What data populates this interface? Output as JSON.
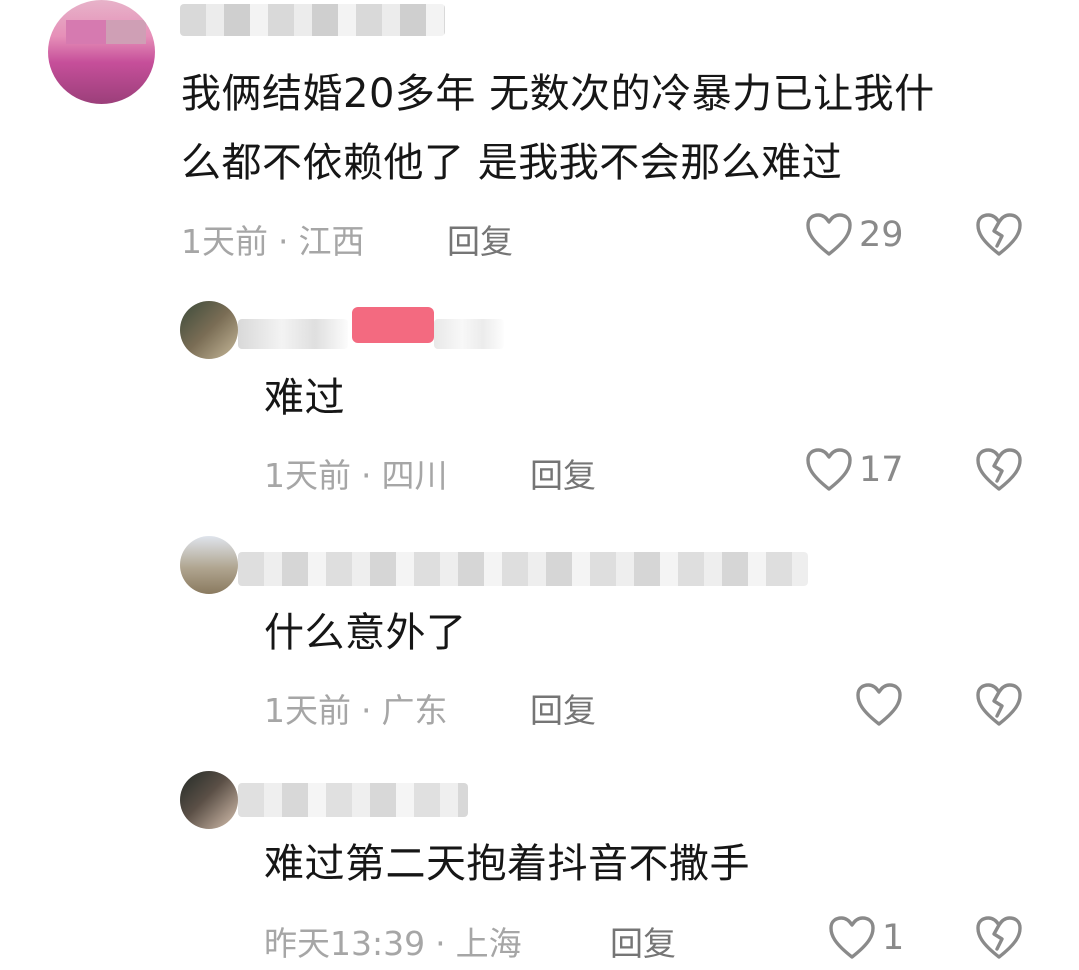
{
  "colors": {
    "text": "#161616",
    "meta": "#a6a6a6",
    "reply": "#757575",
    "icon_stroke": "#8a8a8a",
    "author_badge": "#f25a72"
  },
  "icons": {
    "like": "heart-outline-icon",
    "dislike": "broken-heart-icon"
  },
  "comments": [
    {
      "text_lines": [
        "我俩结婚20多年  无数次的冷暴力已让我什",
        "么都不依赖他了  是我我不会那么难过"
      ],
      "time": "1天前",
      "location": "江西",
      "reply_label": "回复",
      "likes": "29"
    },
    {
      "text_lines": [
        "难过"
      ],
      "time": "1天前",
      "location": "四川",
      "reply_label": "回复",
      "likes": "17"
    },
    {
      "text_lines": [
        "什么意外了"
      ],
      "time": "1天前",
      "location": "广东",
      "reply_label": "回复",
      "likes": ""
    },
    {
      "text_lines": [
        "难过第二天抱着抖音不撒手"
      ],
      "time": "昨天13:39",
      "location": "上海",
      "reply_label": "回复",
      "likes": "1"
    }
  ]
}
